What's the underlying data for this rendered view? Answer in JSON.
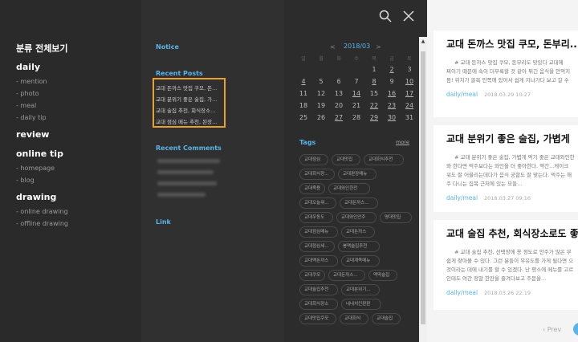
{
  "categories": {
    "all": "분류 전체보기",
    "groups": [
      {
        "label": "daily",
        "subs": [
          "- mention",
          "- photo",
          "- meal",
          "- daily tip"
        ]
      },
      {
        "label": "review",
        "subs": []
      },
      {
        "label": "online tip",
        "subs": [
          "- homepage",
          "- blog"
        ]
      },
      {
        "label": "drawing",
        "subs": [
          "- online drawing",
          "- offline drawing"
        ]
      }
    ]
  },
  "sections": {
    "notice": "Notice",
    "recent_posts": "Recent Posts",
    "recent_comments": "Recent Comments",
    "link": "Link"
  },
  "recent_posts": [
    "교대 돈까스 맛집 쿠모, 돈...",
    "교대 분위기 좋은 술집, 가...",
    "교대 술집 추천, 회식장소...",
    "교대 점심 메뉴 추천, 된장..."
  ],
  "calendar": {
    "prev": "<",
    "title": "2018/03",
    "next": ">",
    "dow": [
      "일",
      "월",
      "화",
      "수",
      "목",
      "금",
      "토"
    ],
    "rows": [
      [
        "",
        "",
        "",
        "",
        "1",
        "2",
        "3"
      ],
      [
        "4",
        "5",
        "6",
        "7",
        "8",
        "9",
        "10"
      ],
      [
        "11",
        "12",
        "13",
        "14",
        "15",
        "16",
        "17"
      ],
      [
        "18",
        "19",
        "20",
        "21",
        "22",
        "23",
        "24"
      ],
      [
        "25",
        "26",
        "27",
        "28",
        "29",
        "30",
        "31"
      ]
    ]
  },
  "tags": {
    "title": "Tags",
    "more": "more",
    "items": [
      [
        "교대점심",
        "교대맛집",
        "교대회식추천"
      ],
      [
        "교대회식장...",
        "교대판장메뉴"
      ],
      [
        "교대족용",
        "교대와인한잔"
      ],
      [
        "교대오늘뭐...",
        "교대돈까스..."
      ],
      [
        "교대우동도",
        "교대와인안주",
        "명대맛집"
      ],
      [
        "교대점심메뉴",
        "교대돈까스"
      ],
      [
        "교대점심세...",
        "봉맥술집추천"
      ],
      [
        "교대맥돈까스",
        "교대계족메뉴"
      ],
      [
        "교대쿠모",
        "교대돈까스...",
        "맥딱술집"
      ],
      [
        "교대술집추천",
        "교대분위기..."
      ],
      [
        "교대회식장소",
        "네네치킨판판"
      ],
      [
        "교대맛집쿠모",
        "교대회식",
        "교대술집"
      ]
    ]
  },
  "posts": [
    {
      "title": "교대 돈까스 맛집 쿠모, 돈부리...",
      "lines": [
        "# 교대 돈까스 맛집 쿠모, 돈부리도 맛있다   교대에",
        "찌이기 때문에 속이 더부룩할 것 같아 튀긴 음식을 안먹지",
        "듬!   위치가 골목 안쪽에 있어서 쉽게 지나가다 보고 갈 수"
      ],
      "category": "daily/meal",
      "date": "2018.03.29 10:27"
    },
    {
      "title": "교대 분위기 좋은 술집, 가볍게",
      "lines": [
        "# 교대 분위기 좋은 술집, 가볍게 먹기 좋은 교대와인한",
        "와 한다면 먹주보다는 와인을 더 좋아한다. 약간...케이크",
        "워도 잘 어울리는데다가 음식 궁합도 잘 맞는다. 먹주는 해",
        "주 다니는 집목 근처에 있는 모들..."
      ],
      "category": "daily/meal",
      "date": "2018.03.27 09:16"
    },
    {
      "title": "교대 술집 추천, 회식장소로도 좋",
      "lines": [
        "# 교대 술집 추천, 선택장에 용 정도로 안주가 많은 무",
        "쉽게 찾아볼 수 있다. 그런 분들이 무유도를 가게 될다면 으",
        "것이라는 데에 내기를 할 수 있겠다. 난 평소에 메뉴를 고르",
        "인테도 여간 정말 한잔을 즐겨다보고 주문을..."
      ],
      "category": "daily/meal",
      "date": "2018.03.26 22:19"
    }
  ],
  "pager": {
    "prev": "‹ Prev"
  }
}
